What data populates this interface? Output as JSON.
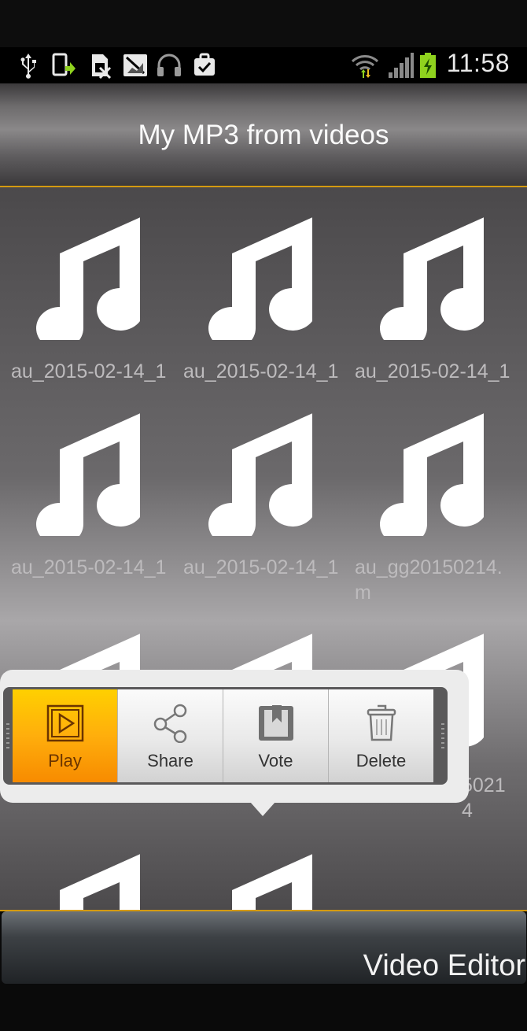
{
  "status_bar": {
    "clock": "11:58",
    "icons": [
      "usb-icon",
      "screenshot-icon",
      "sim-icon",
      "no-signal-icon",
      "headset-icon",
      "task-done-icon",
      "wifi-icon",
      "signal-icon",
      "battery-icon"
    ]
  },
  "app": {
    "title": "My MP3 from videos"
  },
  "grid": {
    "items": [
      {
        "name": "au_2015-02-14_1"
      },
      {
        "name": "au_2015-02-14_1"
      },
      {
        "name": "au_2015-02-14_1"
      },
      {
        "name": "au_2015-02-14_1"
      },
      {
        "name": "au_2015-02-14_1"
      },
      {
        "name": "au_gg20150214.m"
      },
      {
        "name": ""
      },
      {
        "name": ""
      },
      {
        "name": "5021\n4"
      },
      {
        "name": ""
      },
      {
        "name": ""
      }
    ]
  },
  "popup": {
    "actions": [
      {
        "label": "Play",
        "icon": "play-icon"
      },
      {
        "label": "Share",
        "icon": "share-icon"
      },
      {
        "label": "Vote",
        "icon": "vote-icon"
      },
      {
        "label": "Delete",
        "icon": "trash-icon"
      }
    ]
  },
  "bottom_bar": {
    "label": "Video Editor"
  },
  "colors": {
    "accent": "#d49a10",
    "play_active": "#ffae0c"
  }
}
